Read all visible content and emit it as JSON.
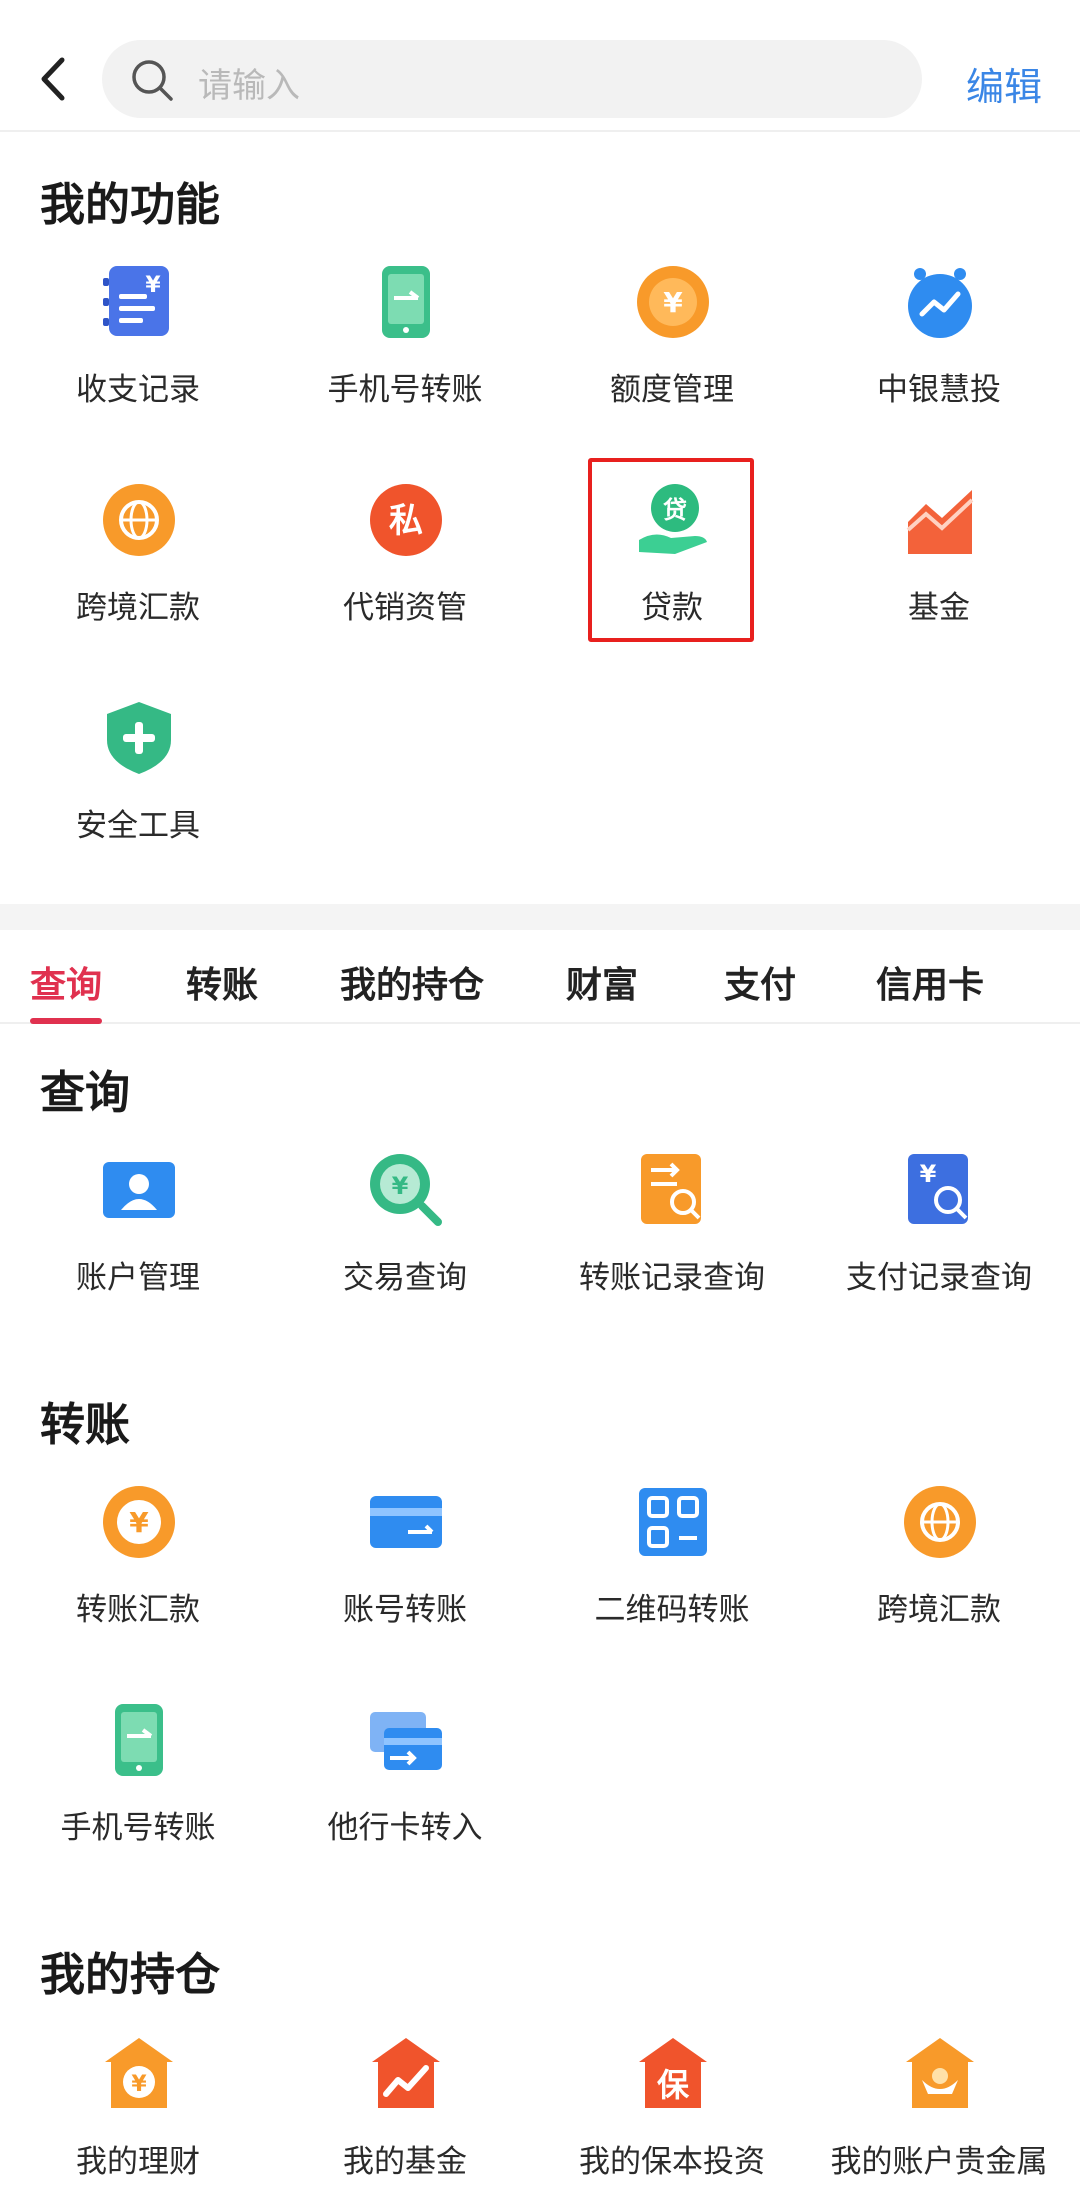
{
  "header": {
    "search_placeholder": "请输入",
    "edit_label": "编辑"
  },
  "my_functions": {
    "title": "我的功能",
    "items": [
      {
        "label": "收支记录",
        "icon": "ledger-icon"
      },
      {
        "label": "手机号转账",
        "icon": "phone-transfer-icon"
      },
      {
        "label": "额度管理",
        "icon": "yuan-coin-icon"
      },
      {
        "label": "中银慧投",
        "icon": "robot-invest-icon"
      },
      {
        "label": "跨境汇款",
        "icon": "globe-coin-icon"
      },
      {
        "label": "代销资管",
        "icon": "private-badge-icon"
      },
      {
        "label": "贷款",
        "icon": "loan-hand-icon"
      },
      {
        "label": "基金",
        "icon": "fund-chart-icon"
      },
      {
        "label": "安全工具",
        "icon": "shield-plus-icon"
      }
    ]
  },
  "tabs": [
    {
      "label": "查询",
      "active": true
    },
    {
      "label": "转账",
      "active": false
    },
    {
      "label": "我的持仓",
      "active": false
    },
    {
      "label": "财富",
      "active": false
    },
    {
      "label": "支付",
      "active": false
    },
    {
      "label": "信用卡",
      "active": false
    }
  ],
  "query": {
    "title": "查询",
    "items": [
      {
        "label": "账户管理",
        "icon": "account-card-icon"
      },
      {
        "label": "交易查询",
        "icon": "yuan-search-icon"
      },
      {
        "label": "转账记录查询",
        "icon": "transfer-record-search-icon"
      },
      {
        "label": "支付记录查询",
        "icon": "payment-record-search-icon"
      }
    ]
  },
  "transfer": {
    "title": "转账",
    "items": [
      {
        "label": "转账汇款",
        "icon": "yuan-coin-icon"
      },
      {
        "label": "账号转账",
        "icon": "card-transfer-icon"
      },
      {
        "label": "二维码转账",
        "icon": "qr-transfer-icon"
      },
      {
        "label": "跨境汇款",
        "icon": "globe-coin-icon"
      },
      {
        "label": "手机号转账",
        "icon": "phone-transfer-icon"
      },
      {
        "label": "他行卡转入",
        "icon": "cards-in-icon"
      }
    ]
  },
  "holdings": {
    "title": "我的持仓",
    "items": [
      {
        "label": "我的理财",
        "icon": "house-yuan-icon"
      },
      {
        "label": "我的基金",
        "icon": "house-chart-icon"
      },
      {
        "label": "我的保本投资",
        "icon": "house-bao-icon"
      },
      {
        "label": "我的账户贵金属",
        "icon": "house-gold-icon"
      }
    ]
  },
  "colors": {
    "accent": "#e0314f",
    "link": "#3a86e6",
    "highlight_box": "#e8201e"
  }
}
